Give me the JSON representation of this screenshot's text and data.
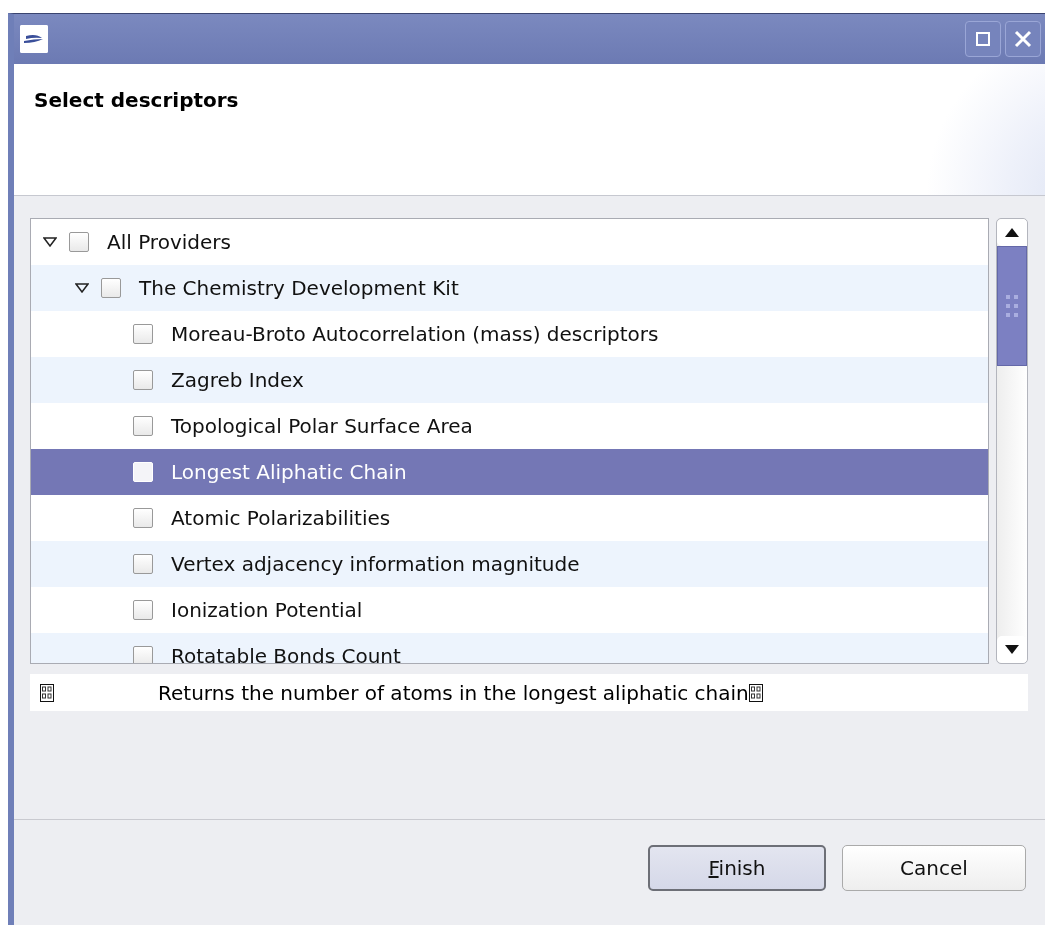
{
  "window": {
    "title_buttons": [
      {
        "kind": "maximize"
      },
      {
        "kind": "close"
      }
    ]
  },
  "header": {
    "title": "Select descriptors"
  },
  "tree": {
    "items": [
      {
        "label": "All Providers",
        "checked": false,
        "expanded": true,
        "selected": false,
        "children": [
          {
            "label": "The Chemistry Development Kit",
            "checked": false,
            "expanded": true,
            "selected": false,
            "children": [
              {
                "label": "Moreau-Broto Autocorrelation (mass) descriptors",
                "checked": false,
                "selected": false
              },
              {
                "label": "Zagreb Index",
                "checked": false,
                "selected": false
              },
              {
                "label": "Topological Polar Surface Area",
                "checked": false,
                "selected": false
              },
              {
                "label": "Longest Aliphatic Chain",
                "checked": false,
                "selected": true
              },
              {
                "label": "Atomic Polarizabilities",
                "checked": false,
                "selected": false
              },
              {
                "label": "Vertex adjacency information magnitude",
                "checked": false,
                "selected": false
              },
              {
                "label": "Ionization Potential",
                "checked": false,
                "selected": false
              },
              {
                "label": "Rotatable Bonds Count",
                "checked": false,
                "selected": false
              }
            ]
          }
        ]
      }
    ]
  },
  "description": {
    "text": "Returns the number of atoms in the longest aliphatic chain"
  },
  "buttons": [
    {
      "label": "Finish",
      "mnemonic": true,
      "default": true
    },
    {
      "label": "Cancel",
      "default": false
    }
  ]
}
